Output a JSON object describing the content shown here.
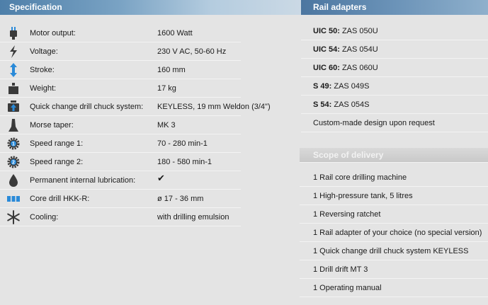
{
  "specification": {
    "title": "Specification",
    "rows": [
      {
        "icon": "motor-icon",
        "label": "Motor output:",
        "value": "1600 Watt"
      },
      {
        "icon": "lightning-icon",
        "label": "Voltage:",
        "value": "230 V AC, 50-60 Hz"
      },
      {
        "icon": "stroke-arrow-icon",
        "label": "Stroke:",
        "value": "160 mm"
      },
      {
        "icon": "weight-icon",
        "label": "Weight:",
        "value": "17 kg"
      },
      {
        "icon": "quick-change-icon",
        "label": "Quick change drill chuck system:",
        "value": "KEYLESS, 19 mm Weldon (3/4\")"
      },
      {
        "icon": "morse-taper-icon",
        "label": "Morse taper:",
        "value": "MK 3"
      },
      {
        "icon": "gear-1-icon",
        "label": "Speed range 1:",
        "value": "70 - 280 min-1"
      },
      {
        "icon": "gear-2-icon",
        "label": "Speed range 2:",
        "value": "180 - 580 min-1"
      },
      {
        "icon": "oil-drop-icon",
        "label": "Permanent internal lubrication:",
        "value": "✔"
      },
      {
        "icon": "core-drill-icon",
        "label": "Core drill HKK-R:",
        "value": "ø 17 - 36 mm"
      },
      {
        "icon": "snowflake-icon",
        "label": "Cooling:",
        "value": "with drilling emulsion"
      }
    ]
  },
  "rail_adapters": {
    "title": "Rail adapters",
    "items": [
      {
        "bold": "UIC 50:",
        "text": " ZAS 050U"
      },
      {
        "bold": "UIC 54:",
        "text": " ZAS 054U"
      },
      {
        "bold": "UIC 60:",
        "text": " ZAS 060U"
      },
      {
        "bold": "S 49:",
        "text": " ZAS 049S"
      },
      {
        "bold": "S 54:",
        "text": " ZAS 054S"
      },
      {
        "bold": "",
        "text": "Custom-made design upon request"
      }
    ]
  },
  "scope_of_delivery": {
    "title": "Scope of delivery",
    "items": [
      "1 Rail core drilling machine",
      "1 High-pressure tank, 5 litres",
      "1 Reversing ratchet",
      "1 Rail adapter of your choice (no special version)",
      "1 Quick change drill chuck system KEYLESS",
      "1 Drill drift MT 3",
      "1 Operating manual"
    ]
  },
  "colors": {
    "background": "#e4e4e4",
    "header_blue": "#4e7fa9",
    "icon_dark": "#3a3a3a",
    "icon_blue": "#2a8ad8"
  }
}
